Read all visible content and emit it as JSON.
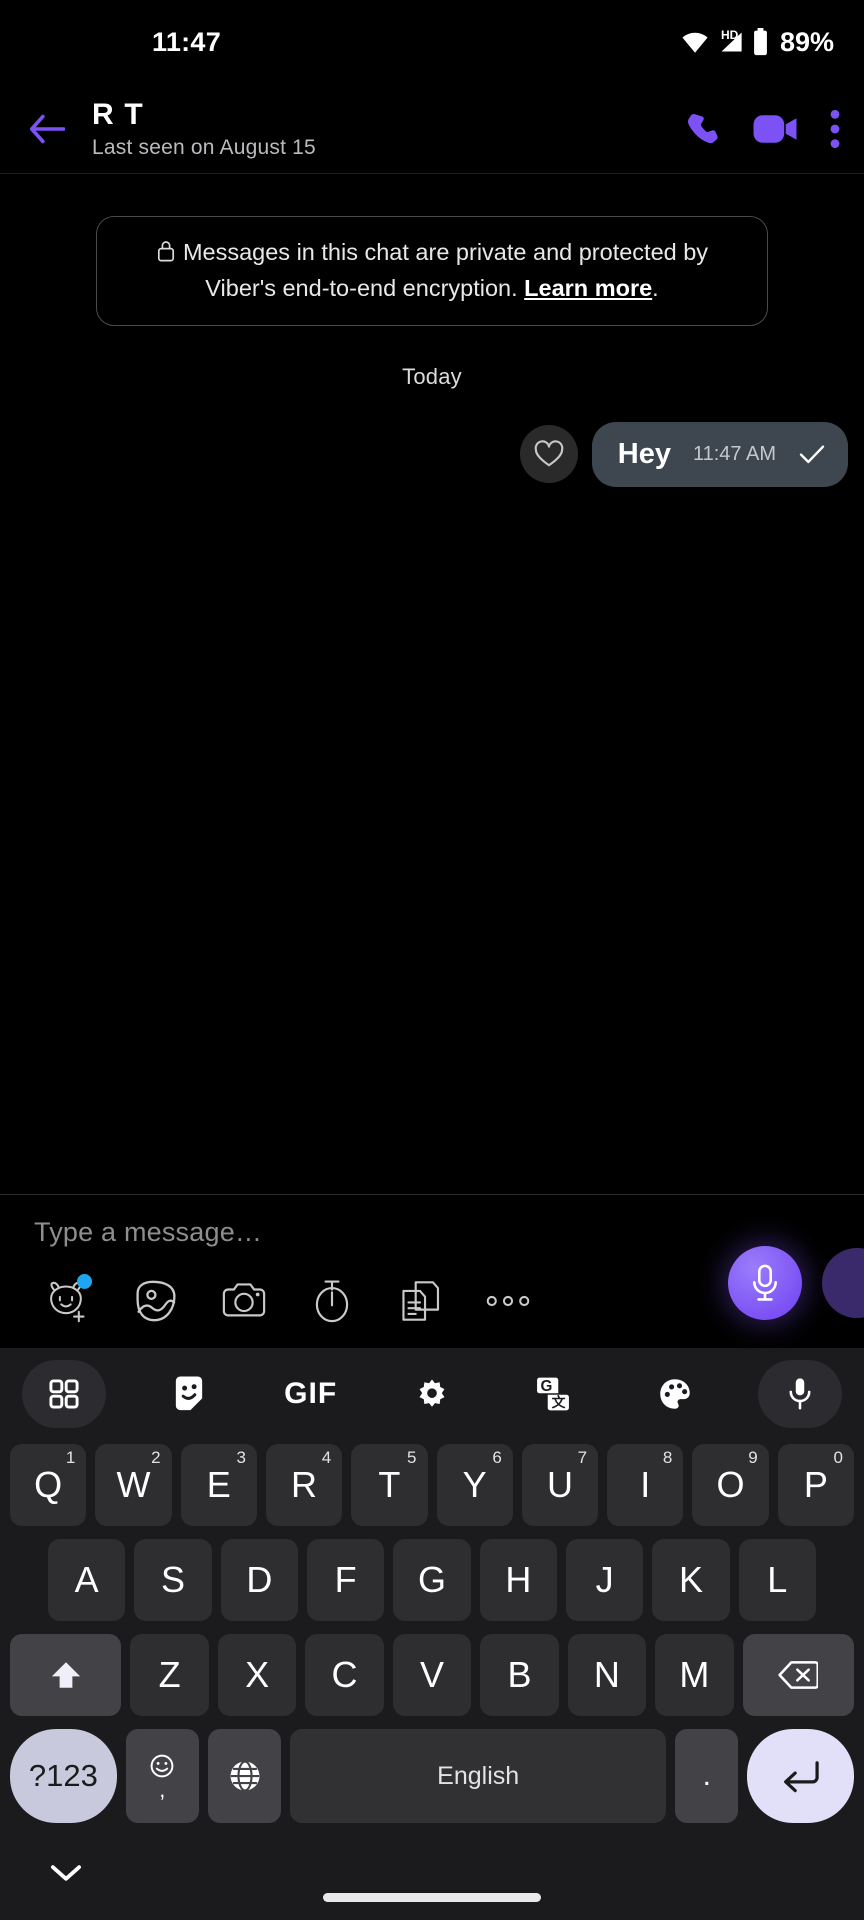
{
  "status_bar": {
    "time": "11:47",
    "battery_percent": "89%",
    "hd_label": "HD",
    "icons": [
      "wifi-icon",
      "hd-signal-icon",
      "battery-icon"
    ]
  },
  "chat_header": {
    "back_icon": "back-arrow-icon",
    "contact_name": "R T",
    "last_seen": "Last seen on August 15",
    "actions": [
      "voice-call-icon",
      "video-call-icon",
      "overflow-menu-icon"
    ],
    "accent_color": "#7c52f4"
  },
  "conversation": {
    "encryption_notice": {
      "lock_icon": "lock-icon",
      "text_before": "Messages in this chat are private and protected by Viber's end-to-end encryption. ",
      "link_label": "Learn more",
      "text_after": "."
    },
    "day_separator": "Today",
    "messages": [
      {
        "text": "Hey",
        "time": "11:47 AM",
        "outgoing": true,
        "status_icon": "sent-check-icon",
        "reaction_icon": "heart-icon",
        "bubble_color": "#3e4750"
      }
    ]
  },
  "input_bar": {
    "placeholder": "Type a message…",
    "attachments": [
      {
        "name": "sticker-bear-icon",
        "badge": true
      },
      {
        "name": "gallery-image-icon",
        "badge": false
      },
      {
        "name": "camera-icon",
        "badge": false
      },
      {
        "name": "timer-icon",
        "badge": false
      },
      {
        "name": "file-document-icon",
        "badge": false
      },
      {
        "name": "more-options-icon",
        "badge": false
      }
    ],
    "mic_button_icon": "microphone-icon",
    "mic_button_color": "#7c52f4"
  },
  "keyboard": {
    "toolbar": [
      {
        "name": "apps-grid-icon",
        "pill": true
      },
      {
        "name": "sticker-icon",
        "pill": false
      },
      {
        "name": "gif-icon",
        "label": "GIF",
        "pill": false
      },
      {
        "name": "settings-gear-icon",
        "pill": false
      },
      {
        "name": "translate-icon",
        "pill": false
      },
      {
        "name": "theme-palette-icon",
        "pill": false
      },
      {
        "name": "voice-input-mic-icon",
        "pill": true
      }
    ],
    "row1": [
      {
        "letter": "Q",
        "num": "1"
      },
      {
        "letter": "W",
        "num": "2"
      },
      {
        "letter": "E",
        "num": "3"
      },
      {
        "letter": "R",
        "num": "4"
      },
      {
        "letter": "T",
        "num": "5"
      },
      {
        "letter": "Y",
        "num": "6"
      },
      {
        "letter": "U",
        "num": "7"
      },
      {
        "letter": "I",
        "num": "8"
      },
      {
        "letter": "O",
        "num": "9"
      },
      {
        "letter": "P",
        "num": "0"
      }
    ],
    "row2": [
      "A",
      "S",
      "D",
      "F",
      "G",
      "H",
      "J",
      "K",
      "L"
    ],
    "row3": {
      "shift_icon": "shift-up-arrow-icon",
      "letters": [
        "Z",
        "X",
        "C",
        "V",
        "B",
        "N",
        "M"
      ],
      "backspace_icon": "backspace-delete-icon"
    },
    "row4": {
      "symbols_label": "?123",
      "emoji_icon": "emoji-smiley-icon",
      "emoji_alt": ",",
      "globe_icon": "language-globe-icon",
      "space_label": "English",
      "period_label": ".",
      "enter_icon": "enter-return-icon"
    }
  },
  "nav_bar": {
    "hide_keyboard_icon": "chevron-down-icon",
    "home_indicator": "home-gesture-pill"
  }
}
